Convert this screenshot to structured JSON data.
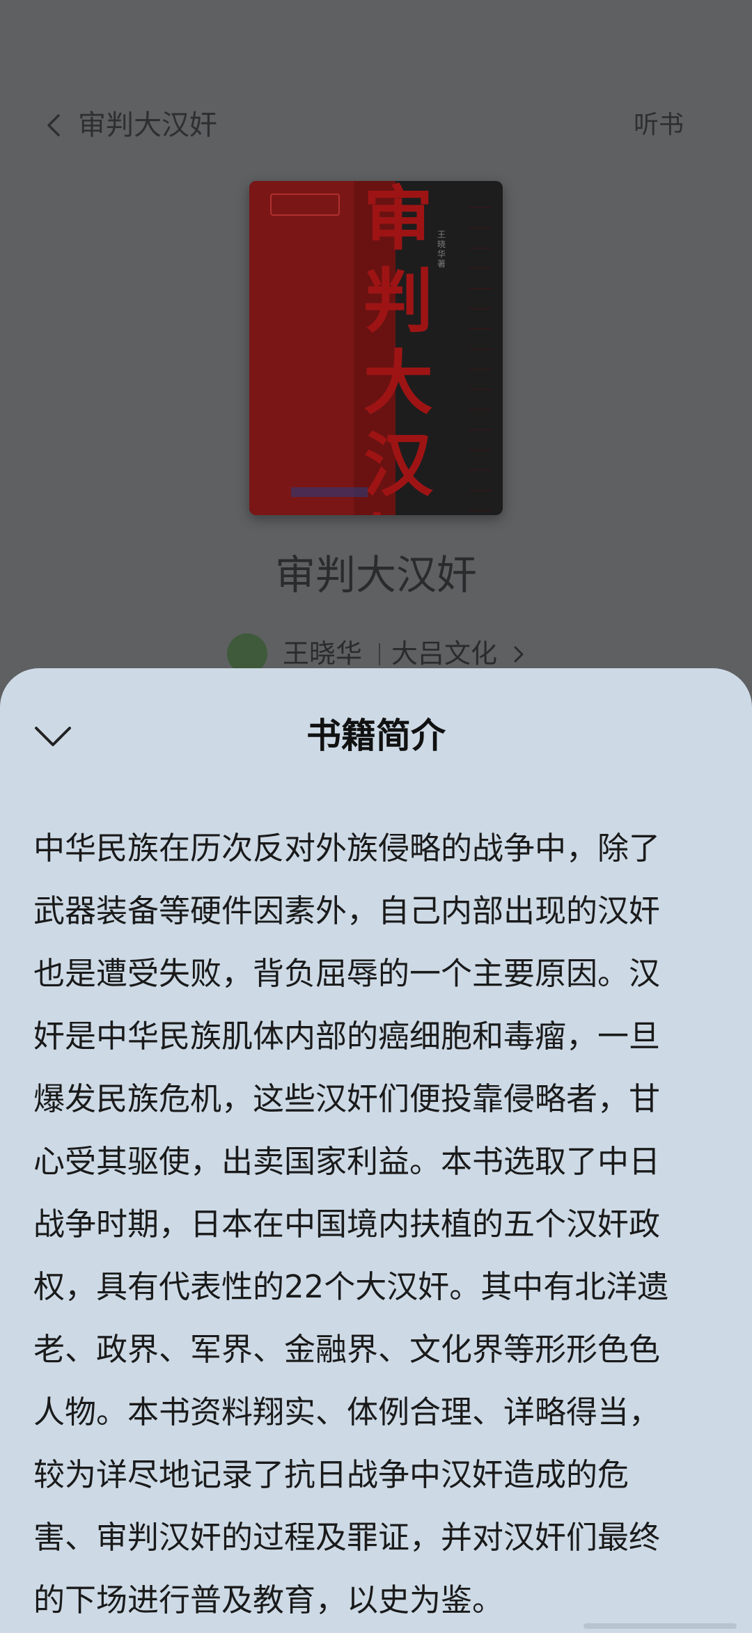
{
  "header": {
    "title": "审判大汉奸",
    "listen_label": "听书"
  },
  "book": {
    "title": "审判大汉奸",
    "cover_title": "审判大汉奸",
    "cover_author": "王晓华著",
    "author": "王晓华",
    "publisher": "大吕文化"
  },
  "sheet": {
    "title": "书籍简介",
    "intro_lines": [
      "中华民族在历次反对外族侵略的战争中，除了",
      "武器装备等硬件因素外，自己内部出现的汉奸",
      "也是遭受失败，背负屈辱的一个主要原因。汉",
      "奸是中华民族肌体内部的癌细胞和毒瘤，一旦",
      "爆发民族危机，这些汉奸们便投靠侵略者，甘",
      "心受其驱使，出卖国家利益。本书选取了中日",
      "战争时期，日本在中国境内扶植的五个汉奸政",
      "权，具有代表性的22个大汉奸。其中有北洋遗",
      "老、政界、军界、金融界、文化界等形形色色",
      "人物。本书资料翔实、体例合理、详略得当，",
      "较为详尽地记录了抗日战争中汉奸造成的危",
      "害、审判汉奸的过程及罪证，并对汉奸们最终",
      "的下场进行普及教育，以史为鉴。"
    ]
  },
  "icons": {
    "back": "chevron-left-icon",
    "collapse": "chevron-down-icon",
    "publisher_link": "chevron-right-icon"
  },
  "colors": {
    "page_background": "#5f6062",
    "sheet_background": "#cddae6",
    "cover_red": "#9e1414"
  }
}
